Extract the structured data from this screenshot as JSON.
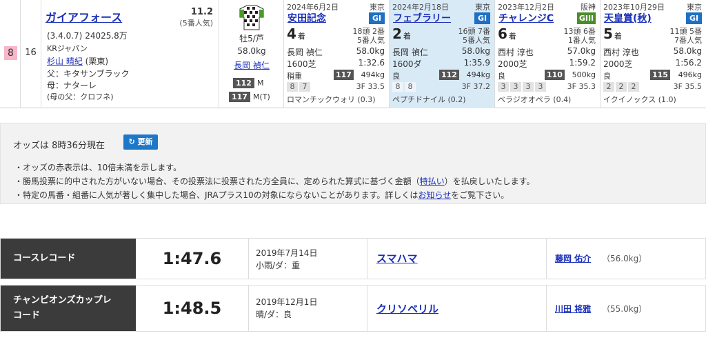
{
  "horse": {
    "frame": "8",
    "number": "16",
    "name": "ガイアフォース",
    "odds": "11.2",
    "popularity": "(5番人気)",
    "record": "(3.4.0.7)",
    "earnings": "24025.8万",
    "owner": "KRジャパン",
    "trainer": "杉山 晴紀",
    "trainer_region": "(栗東)",
    "sire": "父：キタサンブラック",
    "dam": "母：ナターレ",
    "damsire": "(母の父：クロフネ)",
    "sex_age": "牡5/芦",
    "weight": "58.0kg",
    "jockey": "長岡 禎仁",
    "rating1": "112",
    "rating1_label": "M",
    "rating2": "117",
    "rating2_label": "M(T)"
  },
  "past_races": [
    {
      "date": "2024年6月2日",
      "venue": "東京",
      "race": "安田記念",
      "grade": "GI",
      "place": "4",
      "place_suffix": "着",
      "field": "18頭 2番",
      "field_pop": "5番人気",
      "jockey": "長岡 禎仁",
      "kg": "58.0kg",
      "distance": "1600芝",
      "time": "1:32.6",
      "condition": "稍重",
      "rate": "117",
      "body_weight": "494kg",
      "passing": [
        "8",
        "7"
      ],
      "last3f": "3F 33.5",
      "winner": "ロマンチックウォリ (0.3)"
    },
    {
      "date": "2024年2月18日",
      "venue": "東京",
      "race": "フェブラリー",
      "grade": "GI",
      "place": "2",
      "place_suffix": "着",
      "field": "16頭 7番",
      "field_pop": "5番人気",
      "jockey": "長岡 禎仁",
      "kg": "58.0kg",
      "distance": "1600ダ",
      "time": "1:35.9",
      "condition": "良",
      "rate": "112",
      "body_weight": "494kg",
      "passing": [
        "8",
        "8"
      ],
      "last3f": "3F 37.2",
      "winner": "ペプチドナイル (0.2)"
    },
    {
      "date": "2023年12月2日",
      "venue": "阪神",
      "race": "チャレンジC",
      "grade": "GIII",
      "place": "6",
      "place_suffix": "着",
      "field": "13頭 6番",
      "field_pop": "1番人気",
      "jockey": "西村 淳也",
      "kg": "57.0kg",
      "distance": "2000芝",
      "time": "1:59.2",
      "condition": "良",
      "rate": "110",
      "body_weight": "500kg",
      "passing": [
        "3",
        "3",
        "3",
        "3"
      ],
      "last3f": "3F 35.3",
      "winner": "ベラジオオペラ (0.4)"
    },
    {
      "date": "2023年10月29日",
      "venue": "東京",
      "race": "天皇賞(秋)",
      "grade": "GI",
      "place": "5",
      "place_suffix": "着",
      "field": "11頭 5番",
      "field_pop": "7番人気",
      "jockey": "西村 淳也",
      "kg": "58.0kg",
      "distance": "2000芝",
      "time": "1:56.2",
      "condition": "良",
      "rate": "115",
      "body_weight": "496kg",
      "passing": [
        "2",
        "2",
        "2"
      ],
      "last3f": "3F 35.5",
      "winner": "イクイノックス (1.0)"
    }
  ],
  "odds_notice": {
    "time_text": "オッズは 8時36分現在",
    "refresh_label": "更新",
    "note1": "・オッズの赤表示は、10倍未満を示します。",
    "note2_pre": "・勝馬投票に的中された方がいない場合、その投票法に投票された方全員に、定められた算式に基づく金額（",
    "note2_link": "特払い",
    "note2_post": "）を払戻しいたします。",
    "note3_pre": "・特定の馬番・組番に人気が著しく集中した場合、JRAプラス10の対象にならないことがあります。詳しくは",
    "note3_link": "お知らせ",
    "note3_post": "をご覧下さい。"
  },
  "records": [
    {
      "label_line1": "コースレコード",
      "label_line2": "",
      "time": "1:47.6",
      "date": "2019年7月14日",
      "conditions": "小雨/ダ：重",
      "horse": "スマハマ",
      "jockey": "藤岡 佑介",
      "jockey_kg": "（56.0kg）"
    },
    {
      "label_line1": "チャンピオンズカップレ",
      "label_line2": "コード",
      "time": "1:48.5",
      "date": "2019年12月1日",
      "conditions": "晴/ダ：良",
      "horse": "クリソベリル",
      "jockey": "川田 将雅",
      "jockey_kg": "（55.0kg）"
    }
  ],
  "icons": {
    "refresh": "refresh-icon",
    "silks": "jockey-silks-icon"
  }
}
